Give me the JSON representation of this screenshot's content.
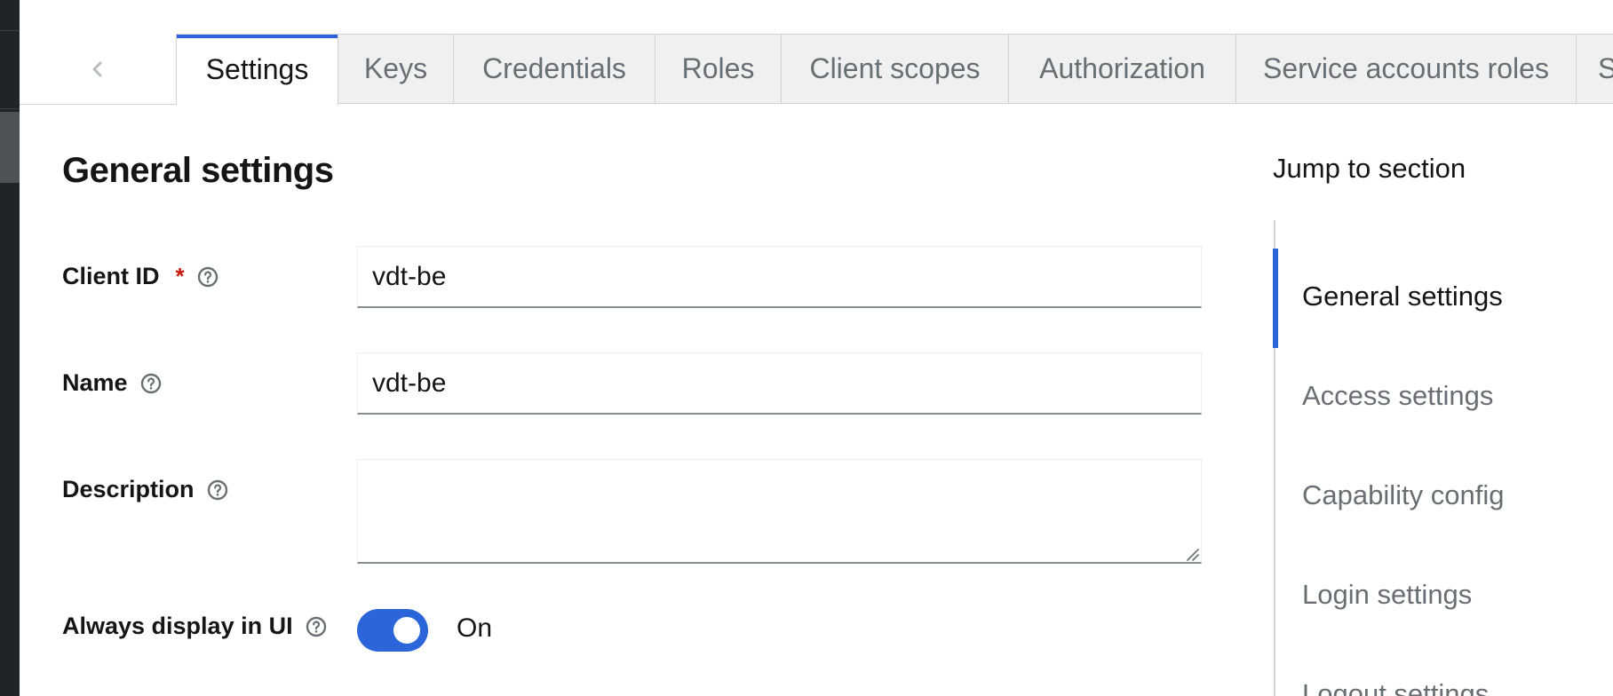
{
  "tabs": {
    "scroll_left_icon": "chevron-left-icon",
    "items": [
      {
        "label": "Settings",
        "active": true
      },
      {
        "label": "Keys",
        "active": false
      },
      {
        "label": "Credentials",
        "active": false
      },
      {
        "label": "Roles",
        "active": false
      },
      {
        "label": "Client scopes",
        "active": false
      },
      {
        "label": "Authorization",
        "active": false
      },
      {
        "label": "Service accounts roles",
        "active": false
      },
      {
        "label": "S",
        "active": false
      }
    ]
  },
  "form": {
    "title": "General settings",
    "client_id": {
      "label": "Client ID",
      "required_marker": "*",
      "value": "vdt-be",
      "help_icon": "help-circle-icon"
    },
    "name": {
      "label": "Name",
      "value": "vdt-be",
      "help_icon": "help-circle-icon"
    },
    "description": {
      "label": "Description",
      "value": "",
      "help_icon": "help-circle-icon"
    },
    "always_display": {
      "label": "Always display in UI",
      "state_label": "On",
      "enabled": true,
      "help_icon": "help-circle-icon"
    }
  },
  "jump": {
    "title": "Jump to section",
    "items": [
      {
        "label": "General settings",
        "active": true
      },
      {
        "label": "Access settings",
        "active": false
      },
      {
        "label": "Capability config",
        "active": false
      },
      {
        "label": "Login settings",
        "active": false
      },
      {
        "label": "Logout settings",
        "active": false
      }
    ]
  },
  "colors": {
    "accent": "#2b65d9",
    "required": "#c9190b",
    "muted_text": "#6a6e73",
    "sidebar_dark": "#212427"
  }
}
